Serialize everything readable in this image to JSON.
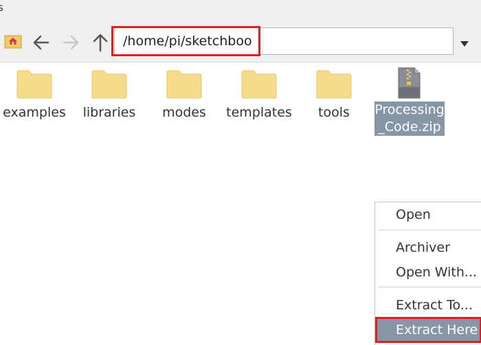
{
  "window": {
    "title_fragment": "s"
  },
  "toolbar": {
    "path_value": "/home/pi/sketchbook",
    "icons": [
      "home-icon",
      "back-arrow-icon",
      "forward-arrow-icon",
      "up-arrow-icon",
      "dropdown-triangle-icon"
    ]
  },
  "files": [
    {
      "name": "examples",
      "type": "folder"
    },
    {
      "name": "libraries",
      "type": "folder"
    },
    {
      "name": "modes",
      "type": "folder"
    },
    {
      "name": "templates",
      "type": "folder"
    },
    {
      "name": "tools",
      "type": "folder"
    },
    {
      "name_line1": "Processing",
      "name_line2": "_Code.zip",
      "type": "zip-archive",
      "selected": true
    }
  ],
  "context_menu": {
    "items": [
      "Open",
      "Archiver",
      "Open With...",
      "Extract To...",
      "Extract Here"
    ],
    "highlighted": "Extract Here"
  },
  "colors": {
    "selection": "#8797a7",
    "annotation_red": "#e02020",
    "folder_fill": "#f5dc8c",
    "toolbar_bg": "#efefef"
  }
}
